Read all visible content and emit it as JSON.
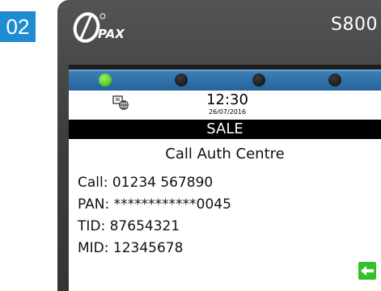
{
  "step": {
    "number": "02"
  },
  "device": {
    "brand": "PAX",
    "model": "S800",
    "leds": [
      {
        "name": "led-1",
        "lit": true
      },
      {
        "name": "led-2",
        "lit": false
      },
      {
        "name": "led-3",
        "lit": false
      },
      {
        "name": "led-4",
        "lit": false
      }
    ],
    "colors": {
      "led_on": "#2cb20e",
      "led_bar": "#27639b",
      "badge": "#1f8bd1",
      "back_button": "#33c12a"
    }
  },
  "screen": {
    "status": {
      "network_icon": "network-icon",
      "time": "12:30",
      "date": "26/07/2016"
    },
    "title": "SALE",
    "heading": "Call Auth Centre",
    "lines": {
      "call": "Call: 01234 567890",
      "pan": "PAN: ************0045",
      "tid": "TID: 87654321",
      "mid": "MID: 12345678"
    },
    "back_icon": "back-arrow-icon"
  }
}
